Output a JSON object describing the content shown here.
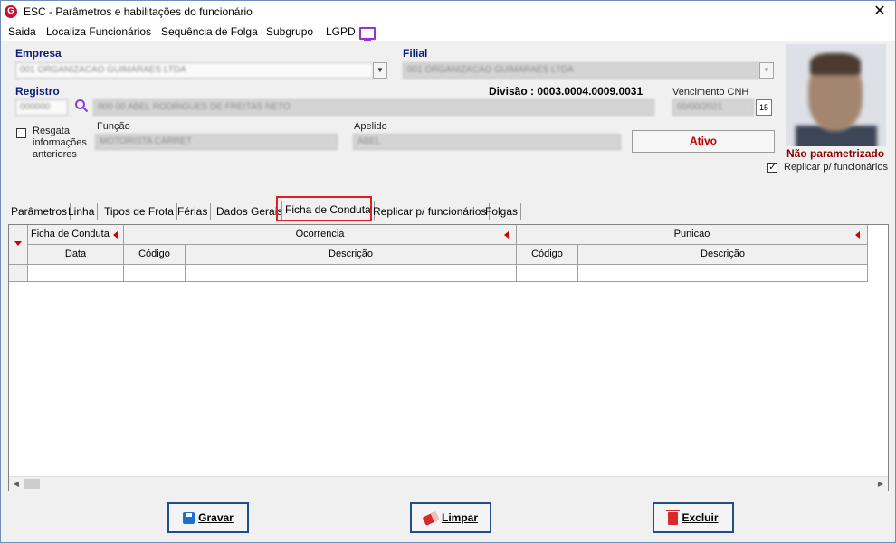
{
  "window": {
    "title": "ESC - Parâmetros e habilitações do funcionário",
    "close_glyph": "✕",
    "logo_letter": "G"
  },
  "menu": [
    "Saida",
    "Localiza Funcionários",
    "Sequência de Folga",
    "Subgrupo",
    "LGPD"
  ],
  "form": {
    "empresa_label": "Empresa",
    "empresa_value": "001 ORGANIZACAO GUIMARAES LTDA",
    "filial_label": "Filial",
    "filial_value": "001 ORGANIZACAO GUIMARAES LTDA",
    "registro_label": "Registro",
    "registro_value": "000000",
    "nome_value": "000 00 ABEL RODRIGUES DE FREITAS NETO",
    "divisao": "Divisão : 0003.0004.0009.0031",
    "vencimento_label": "Vencimento  CNH",
    "vencimento_value": "00/00/2021",
    "calendar_label": "15",
    "resgata_label": "Resgata informações anteriores",
    "funcao_label": "Função",
    "funcao_value": "MOTORISTA CARRET",
    "apelido_label": "Apelido",
    "apelido_value": "ABEL",
    "status_button": "Ativo",
    "photo_status": "Não parametrizado",
    "replicar_label": "Replicar p/ funcionários",
    "replicar_checked": "✓"
  },
  "tabs": [
    "Parâmetros",
    "Linha",
    "Tipos de Frota",
    "Férias",
    "Dados Gerais",
    "Ficha de Conduta",
    "Replicar p/ funcionários",
    "Folgas"
  ],
  "active_tab": "Ficha de Conduta",
  "grid": {
    "group_headers": [
      "Ficha de Conduta",
      "Ocorrencia",
      "Punicao"
    ],
    "columns": [
      "Data",
      "Código",
      "Descrição",
      "Código",
      "Descrição"
    ],
    "rows": [
      [
        "",
        "",
        "",
        "",
        ""
      ]
    ]
  },
  "buttons": {
    "gravar": "Gravar",
    "limpar": "Limpar",
    "excluir": "Excluir"
  },
  "colors": {
    "label_blue": "#0b1f7a",
    "status_red": "#c00000",
    "highlight": "#e02020",
    "button_border": "#1f4d8f"
  }
}
